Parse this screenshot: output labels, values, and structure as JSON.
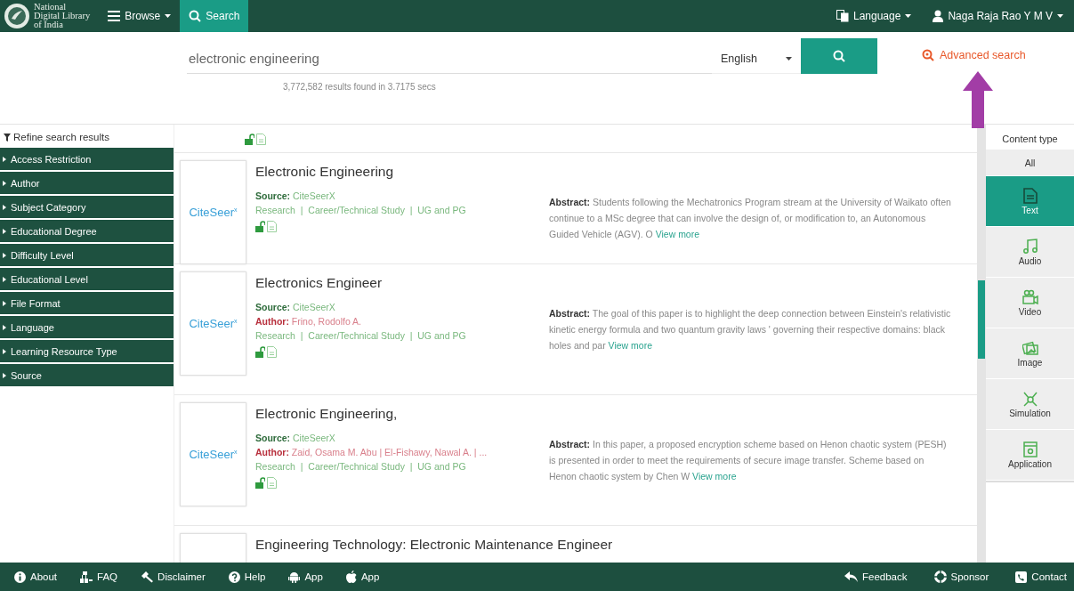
{
  "header": {
    "logo_lines": [
      "National",
      "Digital Library",
      "of India"
    ],
    "nav": [
      {
        "label": "Browse",
        "kind": "menu",
        "selected": false
      },
      {
        "label": "Search",
        "kind": "search",
        "selected": true
      }
    ],
    "language": "Language",
    "user": "Naga Raja Rao Y M V"
  },
  "search": {
    "value": "electronic engineering",
    "language": "English",
    "advanced": "Advanced search",
    "results_count": "3,772,582 results found in 3.7175 secs"
  },
  "sidebar": {
    "title": "Refine search results",
    "items": [
      "Access Restriction",
      "Author",
      "Subject Category",
      "Educational Degree",
      "Difficulty Level",
      "Educational Level",
      "File Format",
      "Language",
      "Learning Resource Type",
      "Source"
    ]
  },
  "results": [
    {
      "kind": "icons"
    },
    {
      "kind": "full",
      "logo": "CiteSeer$^{x}$",
      "title": "Electronic Engineering",
      "source": "**Source:** CiteSeerX",
      "tags": "Research  |  Career/Technical Study  |  UG and PG",
      "abstract": "**Abstract:** Students following the Mechatronics Program stream at the University of Waikato often continue to a MSc degree that can involve the design of, or modification to, an Autonomous Guided Vehicle (AGV). O",
      "view_more": "View more"
    },
    {
      "kind": "full",
      "logo": "CiteSeer$^{x}$",
      "title": "Electronics Engineer",
      "source": "**Source:** CiteSeerX",
      "author": "**Author:** Frino, Rodolfo A.",
      "tags": "Research  |  Career/Technical Study  |  UG and PG",
      "abstract": "**Abstract:** The goal of this paper is to highlight the deep connection between Einstein's relativistic kinetic energy formula and two quantum gravity laws ' governing their respective domains: black holes and par",
      "view_more": "View more"
    },
    {
      "kind": "full",
      "logo": "CiteSeer$^{x}$",
      "title": "Electronic Engineering,",
      "source": "**Source:** CiteSeerX",
      "author": "**Author:** Zaid, Osama M. Abu | El-Fishawy, Nawal A. | ...",
      "tags": "Research  |  Career/Technical Study  |  UG and PG",
      "abstract": "**Abstract:** In this paper, a proposed encryption scheme based on Henon chaotic system (PESH) is presented in order to meet the requirements of secure image transfer. Scheme based on Henon chaotic system by Chen W",
      "view_more": "View more"
    },
    {
      "kind": "title",
      "title": "Engineering Technology: Electronic Maintenance Engineer"
    }
  ],
  "content_types": {
    "title": "Content type",
    "items": [
      {
        "label": "All",
        "kind": "all",
        "selected": false
      },
      {
        "label": "Text",
        "kind": "text",
        "selected": true
      },
      {
        "label": "Audio",
        "kind": "audio",
        "selected": false
      },
      {
        "label": "Video",
        "kind": "video",
        "selected": false
      },
      {
        "label": "Image",
        "kind": "image",
        "selected": false
      },
      {
        "label": "Simulation",
        "kind": "simulation",
        "selected": false
      },
      {
        "label": "Application",
        "kind": "application",
        "selected": false
      }
    ]
  },
  "footer": {
    "left": [
      {
        "label": "About",
        "kind": "info"
      },
      {
        "label": "FAQ",
        "kind": "sitemap"
      },
      {
        "label": "Disclaimer",
        "kind": "gavel"
      },
      {
        "label": "Help",
        "kind": "help"
      },
      {
        "label": "App",
        "kind": "android"
      },
      {
        "label": "App",
        "kind": "apple"
      }
    ],
    "right": [
      {
        "label": "Feedback",
        "kind": "feedback"
      },
      {
        "label": "Sponsor",
        "kind": "sponsor"
      },
      {
        "label": "Contact",
        "kind": "contact"
      }
    ]
  }
}
